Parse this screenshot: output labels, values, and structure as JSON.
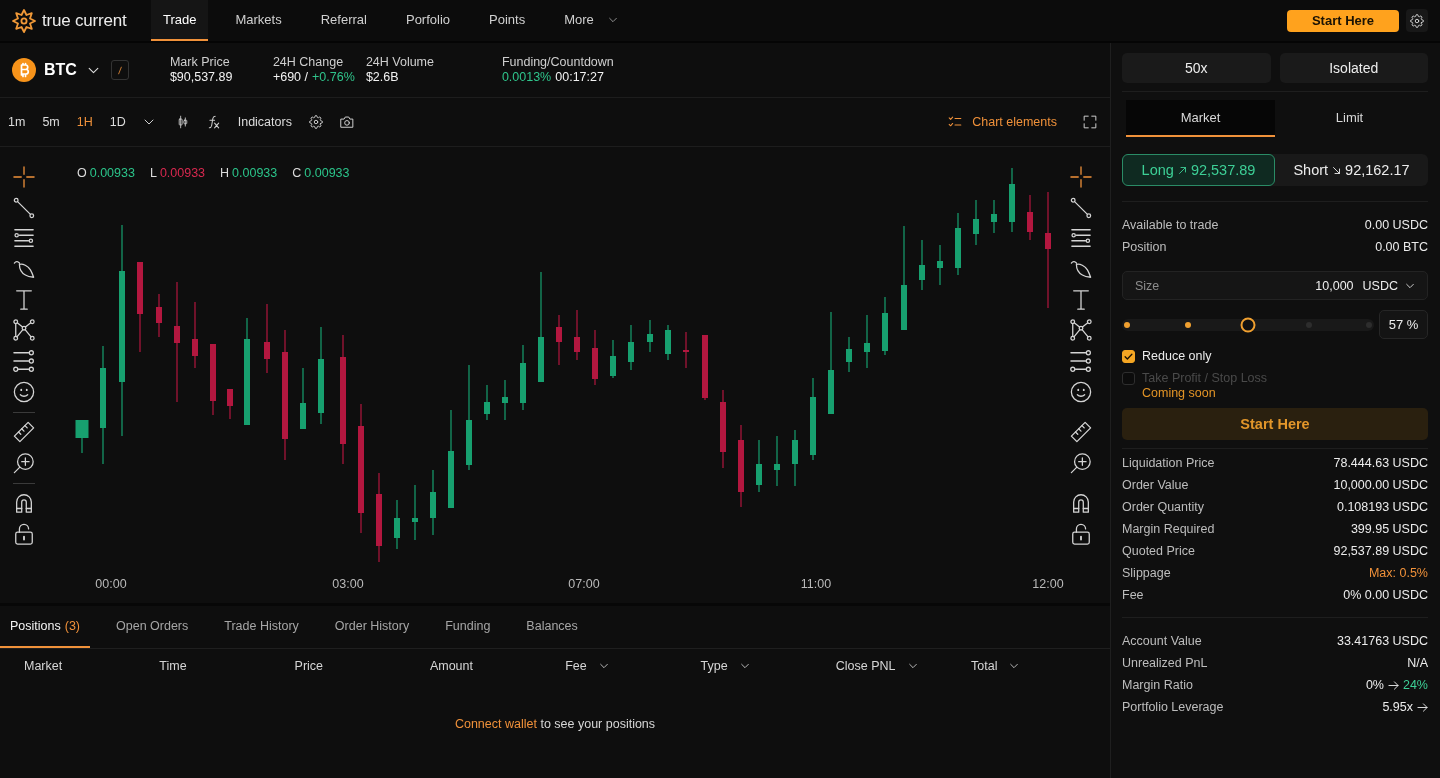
{
  "top_nav": {
    "logo_text": "true current",
    "items": [
      {
        "label": "Trade",
        "selected": true,
        "menu": false
      },
      {
        "label": "Markets",
        "selected": false,
        "menu": false
      },
      {
        "label": "Referral",
        "selected": false,
        "menu": false
      },
      {
        "label": "Porfolio",
        "selected": false,
        "menu": false
      },
      {
        "label": "Points",
        "selected": false,
        "menu": false
      },
      {
        "label": "More",
        "selected": false,
        "menu": true
      }
    ],
    "cta_button": "Start Here"
  },
  "ticker": {
    "symbol": "BTC",
    "stats": [
      {
        "label": "Mark Price",
        "parts": [
          {
            "text": "$90,537.89",
            "kind": "plain"
          }
        ]
      },
      {
        "label": "24H Change",
        "parts": [
          {
            "text": "+690 /",
            "kind": "plain"
          },
          {
            "text": "+0.76%",
            "kind": "up"
          }
        ]
      },
      {
        "label": "24H Volume",
        "parts": [
          {
            "text": "$2.6B",
            "kind": "plain"
          }
        ]
      },
      {
        "label": "Funding/Countdown",
        "parts": [
          {
            "text": "0.0013%",
            "kind": "up"
          },
          {
            "text": "00:17:27",
            "kind": "plain"
          }
        ]
      }
    ]
  },
  "chart_toolbar": {
    "intervals": [
      {
        "label": "1m",
        "selected": false
      },
      {
        "label": "5m",
        "selected": false
      },
      {
        "label": "1H",
        "selected": true
      },
      {
        "label": "1D",
        "selected": false
      }
    ],
    "indicators": "Indicators",
    "chart_elements": "Chart elements"
  },
  "chart": {
    "left_tools": [
      {
        "selected": true
      },
      {
        "selected": false
      },
      {
        "selected": false
      },
      {
        "selected": false
      },
      {
        "selected": false
      },
      {
        "selected": false
      },
      {
        "selected": false
      },
      {
        "selected": false
      },
      {
        "selected": false
      },
      {
        "selected": false
      },
      {
        "selected": false
      },
      {
        "selected": false
      }
    ],
    "ohlc": [
      {
        "label": "O",
        "value": "0.00933",
        "color": "#2bc48a"
      },
      {
        "label": "L",
        "value": "0.00933",
        "color": "#d8284f"
      },
      {
        "label": "H",
        "value": "0.00933",
        "color": "#2bc48a"
      },
      {
        "label": "C",
        "value": "0.00933",
        "color": "#2bc48a"
      }
    ],
    "right_tools": [
      {
        "selected": true
      },
      {
        "selected": false
      },
      {
        "selected": false
      },
      {
        "selected": false
      },
      {
        "selected": false
      },
      {
        "selected": false
      },
      {
        "selected": false
      },
      {
        "selected": false
      },
      {
        "selected": false
      },
      {
        "selected": false
      },
      {
        "selected": false
      },
      {
        "selected": false
      }
    ],
    "x_labels": [
      "00:00",
      "03:00",
      "07:00",
      "11:00",
      "12:00"
    ]
  },
  "positions": {
    "tabs": [
      {
        "label": "Positions",
        "count": "(3)",
        "selected": true
      },
      {
        "label": "Open Orders",
        "selected": false
      },
      {
        "label": "Trade History",
        "selected": false
      },
      {
        "label": "Order History",
        "selected": false
      },
      {
        "label": "Funding",
        "selected": false
      },
      {
        "label": "Balances",
        "selected": false
      }
    ],
    "columns": [
      {
        "label": "Market",
        "filter": false
      },
      {
        "label": "Time",
        "filter": false
      },
      {
        "label": "Price",
        "filter": false
      },
      {
        "label": "Amount",
        "filter": false
      },
      {
        "label": "Fee",
        "filter": true
      },
      {
        "label": "Type",
        "filter": true
      },
      {
        "label": "Close PNL",
        "filter": true
      },
      {
        "label": "Total",
        "filter": true
      }
    ],
    "empty": {
      "link": "Connect wallet",
      "text": "to see your positions"
    }
  },
  "order_panel": {
    "leverage": "50x",
    "margin_mode": "Isolated",
    "order_types": [
      {
        "label": "Market",
        "selected": true
      },
      {
        "label": "Limit",
        "selected": false
      }
    ],
    "sides": [
      {
        "label": "Long",
        "price": "92,537.89",
        "kind": "long",
        "selected": true
      },
      {
        "label": "Short",
        "price": "92,162.17",
        "kind": "short",
        "selected": false
      }
    ],
    "balances": [
      {
        "label": "Available to trade",
        "value": "0.00 USDC"
      },
      {
        "label": "Position",
        "value": "0.00 BTC"
      }
    ],
    "size": {
      "label": "Size",
      "value": "10,000",
      "unit": "USDC"
    },
    "slider": {
      "level": 0.5,
      "percent": "57 %"
    },
    "options": [
      {
        "label": "Reduce only",
        "checked": true,
        "disabled": false
      },
      {
        "label": "Take Profit / Stop Loss",
        "checked": false,
        "disabled": true,
        "note": "Coming soon"
      }
    ],
    "submit": {
      "label": "Start Here",
      "disabled": true
    },
    "summary": [
      {
        "label": "Liquidation Price",
        "value": "78.444.63 USDC",
        "kind": "plain"
      },
      {
        "label": "Order Value",
        "value": "10,000.00 USDC",
        "kind": "plain"
      },
      {
        "label": "Order Quantity",
        "value": "0.108193 USDC",
        "kind": "plain"
      },
      {
        "label": "Margin Required",
        "value": "399.95 USDC",
        "kind": "plain"
      },
      {
        "label": "Quoted Price",
        "value": "92,537.89 USDC",
        "kind": "plain"
      },
      {
        "label": "Slippage",
        "value": "Max: 0.5%",
        "kind": "warning"
      },
      {
        "label": "Fee",
        "value": "0% 0.00 USDC",
        "kind": "plain"
      }
    ],
    "account": [
      {
        "label": "Account Value",
        "value": "33.41763 USDC",
        "arrow": false
      },
      {
        "label": "Unrealized PnL",
        "value": "N/A",
        "arrow": false
      },
      {
        "label": "Margin Ratio",
        "value": "0%",
        "arrow": true,
        "target": "24%"
      },
      {
        "label": "Portfolio Leverage",
        "value": "5.95x",
        "arrow": true
      }
    ]
  }
}
